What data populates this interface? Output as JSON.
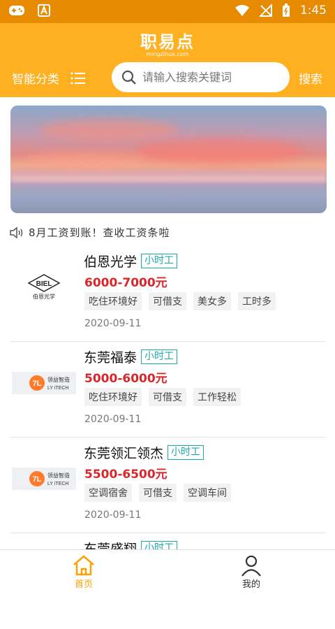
{
  "status_bar": {
    "time": "1:45"
  },
  "header": {
    "logo_text": "职易点",
    "logo_sub": "mingzihua.com",
    "category_label": "智能分类",
    "search_placeholder": "请输入搜索关键词",
    "search_button": "搜索"
  },
  "notice": {
    "text": "8月工资到账！查收工资条啦"
  },
  "jobs": [
    {
      "company": "伯恩光学",
      "type": "小时工",
      "salary": "6000-7000元",
      "tags": [
        "吃住环境好",
        "可借支",
        "美女多",
        "工时多"
      ],
      "date": "2020-09-11",
      "logo_text": "BIEL",
      "logo_sub": "伯恩光学"
    },
    {
      "company": "东莞福泰",
      "type": "小时工",
      "salary": "5000-6000元",
      "tags": [
        "吃住环境好",
        "可借支",
        "工作轻松"
      ],
      "date": "2020-09-11",
      "logo_text": "领益智造",
      "logo_sub": "LY iTECH"
    },
    {
      "company": "东莞领汇领杰",
      "type": "小时工",
      "salary": "5500-6500元",
      "tags": [
        "空调宿舍",
        "可借支",
        "空调车间"
      ],
      "date": "2020-09-11",
      "logo_text": "领益智造",
      "logo_sub": "LY iTECH"
    },
    {
      "company": "东莞盛翔",
      "type": "小时工"
    }
  ],
  "tabbar": {
    "home": "首页",
    "mine": "我的"
  },
  "colors": {
    "header": "#ffb021",
    "statusbar": "#e68a00",
    "salary": "#d9262b",
    "tag_type": "#1aa8a8"
  }
}
